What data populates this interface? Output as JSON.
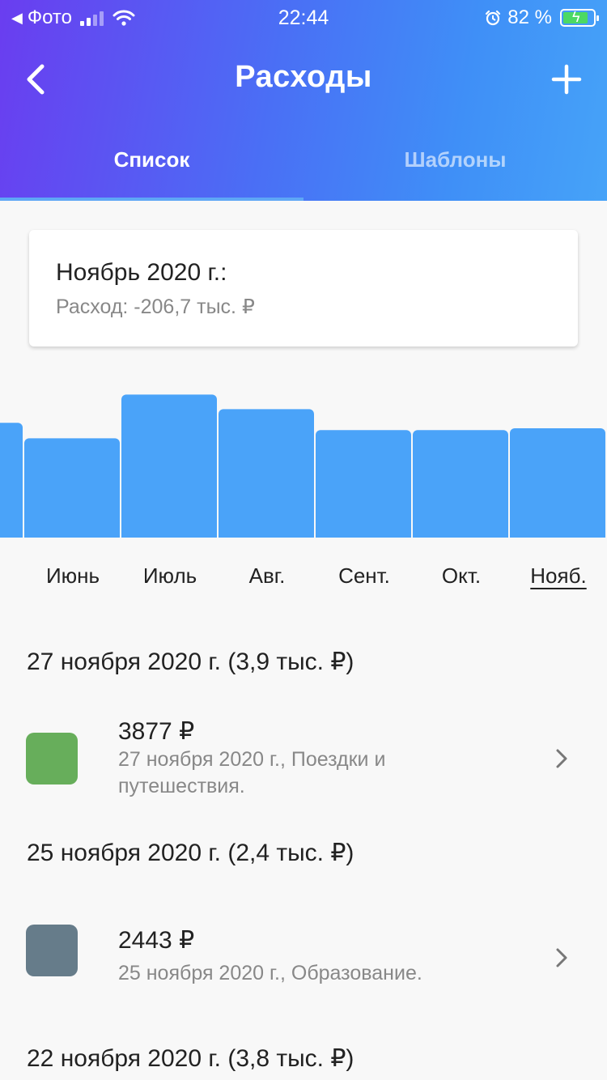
{
  "status_bar": {
    "back_app": "Фото",
    "time": "22:44",
    "battery_percent": "82 %",
    "battery_level": 0.82,
    "signal_bars_active": 2,
    "icons": [
      "back-triangle-icon",
      "signal-icon",
      "wifi-icon",
      "alarm-icon",
      "battery-charging-icon"
    ]
  },
  "nav": {
    "title": "Расходы",
    "back_icon": "chevron-left-icon",
    "add_icon": "plus-icon"
  },
  "tabs": [
    {
      "label": "Список",
      "active": true
    },
    {
      "label": "Шаблоны",
      "active": false
    }
  ],
  "summary": {
    "title": "Ноябрь 2020 г.:",
    "subtitle": "Расход: -206,7 тыс. ₽"
  },
  "chart_data": {
    "type": "bar",
    "categories": [
      "",
      "Июнь",
      "Июль",
      "Авг.",
      "Сент.",
      "Окт.",
      "Нояб."
    ],
    "values": [
      126,
      109,
      157,
      141,
      118,
      118,
      120
    ],
    "selected": "Нояб.",
    "bar_color": "#4aa3f9"
  },
  "month_labels": [
    "Июнь",
    "Июль",
    "Авг.",
    "Сент.",
    "Окт.",
    "Нояб."
  ],
  "days": [
    {
      "header": "27 ноября 2020 г. (3,9 тыс. ₽)",
      "expense": {
        "amount": "3877 ₽",
        "desc": "27 ноября 2020 г., Поездки и путешествия.",
        "color": "#67ae5b"
      }
    },
    {
      "header": "25 ноября 2020 г. (2,4 тыс. ₽)",
      "expense": {
        "amount": "2443 ₽",
        "desc": "25 ноября 2020 г., Образование.",
        "color": "#667c8a"
      }
    },
    {
      "header": "22 ноября 2020 г. (3,8 тыс. ₽)"
    }
  ]
}
